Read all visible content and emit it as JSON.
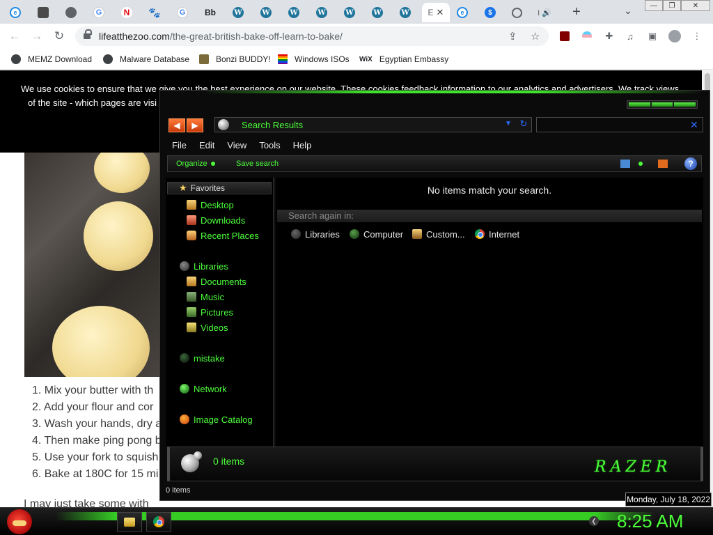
{
  "browser": {
    "tabs": [
      {
        "icon": "ie-icon",
        "glyph": "e"
      },
      {
        "icon": "cube-icon",
        "glyph": ""
      },
      {
        "icon": "chromium-icon",
        "glyph": ""
      },
      {
        "icon": "google-icon",
        "glyph": "G"
      },
      {
        "icon": "netflix-icon",
        "glyph": "N"
      },
      {
        "icon": "paw-icon",
        "glyph": "🐾"
      },
      {
        "icon": "google-icon",
        "glyph": "G"
      },
      {
        "icon": "bb-icon",
        "glyph": "Bb"
      },
      {
        "icon": "wordpress-icon",
        "glyph": "W"
      },
      {
        "icon": "wordpress-icon",
        "glyph": "W"
      },
      {
        "icon": "wordpress-icon",
        "glyph": "W"
      },
      {
        "icon": "wordpress-icon",
        "glyph": "W"
      },
      {
        "icon": "wordpress-icon",
        "glyph": "W"
      },
      {
        "icon": "wordpress-icon",
        "glyph": "W"
      },
      {
        "icon": "wordpress-icon",
        "glyph": "W"
      }
    ],
    "active_tab_glyph": "E",
    "active_tab_close": "✕",
    "after_tabs": [
      {
        "icon": "ie-icon",
        "glyph": "e"
      },
      {
        "icon": "dollar-icon",
        "glyph": "$"
      },
      {
        "icon": "globe-icon",
        "glyph": ""
      },
      {
        "icon": "audio-tab-icon",
        "glyph": "I 🔊"
      }
    ],
    "new_tab": "+",
    "tab_search": "⌄",
    "window_controls": {
      "minimize": "—",
      "restore": "❐",
      "close": "✕"
    },
    "nav": {
      "back": "←",
      "forward": "→",
      "reload": "↻"
    },
    "url_domain": "lifeatthezoo.com",
    "url_path": "/the-great-british-bake-off-learn-to-bake/",
    "share_glyph": "⇪",
    "star_glyph": "☆",
    "extensions": [
      "ublock-icon",
      "flag-icon",
      "puzzle-icon",
      "media-icon",
      "sidepanel-icon",
      "profile-icon",
      "menu-icon"
    ],
    "bookmarks": [
      {
        "label": "MEMZ Download",
        "icon": "globe-icon"
      },
      {
        "label": "Malware Database",
        "icon": "globe-icon"
      },
      {
        "label": "Bonzi BUDDY!",
        "icon": "bonzi-icon"
      },
      {
        "label": "Windows ISOs",
        "icon": "rainbow-flag-icon"
      },
      {
        "label": "Egyptian Embassy",
        "icon": "wix-icon",
        "badge": "WiX"
      }
    ]
  },
  "page": {
    "cookie_line1": "We use cookies to ensure that we give you the best experience on our website. These cookies feedback information to our analytics and advertisers. We track views",
    "cookie_line2": "of the site - which pages are visi",
    "steps": [
      "1. Mix your butter with th",
      "2. Add your flour and cor",
      "3. Wash your hands, dry a",
      "4. Then make ping pong b",
      "5. Use your fork to squish",
      "6. Bake at 180C for 15 mi"
    ],
    "tail": "I may just take some with"
  },
  "explorer": {
    "address": "Search Results",
    "menu": [
      "File",
      "Edit",
      "View",
      "Tools",
      "Help"
    ],
    "commands": {
      "organize": "Organize",
      "save_search": "Save search",
      "help": "?"
    },
    "favorites_header": "Favorites",
    "nav": {
      "desktop": "Desktop",
      "downloads": "Downloads",
      "recent": "Recent Places",
      "libraries": "Libraries",
      "documents": "Documents",
      "music": "Music",
      "pictures": "Pictures",
      "videos": "Videos",
      "mistake": "mistake",
      "network": "Network",
      "image_catalog": "Image Catalog"
    },
    "empty_message": "No items match your search.",
    "search_again": "Search again in:",
    "search_targets": [
      "Libraries",
      "Computer",
      "Custom...",
      "Internet"
    ],
    "details_count": "0 items",
    "brand": "RAZER",
    "status": "0 items"
  },
  "taskbar": {
    "clock": "8:25 AM",
    "date_tooltip": "Monday, July 18, 2022",
    "accent": "#39e026"
  }
}
